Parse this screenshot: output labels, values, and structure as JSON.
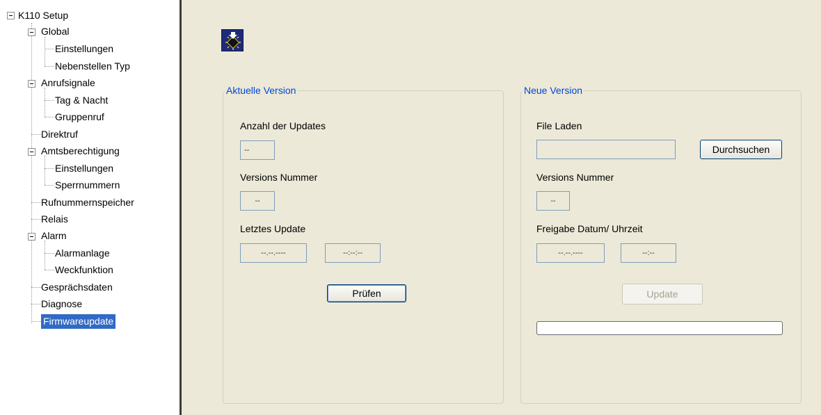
{
  "tree": {
    "root": "K110 Setup",
    "items": [
      {
        "label": "Global"
      },
      {
        "label": "Einstellungen"
      },
      {
        "label": "Nebenstellen Typ"
      },
      {
        "label": "Anrufsignale"
      },
      {
        "label": "Tag & Nacht"
      },
      {
        "label": "Gruppenruf"
      },
      {
        "label": "Direktruf"
      },
      {
        "label": "Amtsberechtigung"
      },
      {
        "label": "Einstellungen"
      },
      {
        "label": "Sperrnummern"
      },
      {
        "label": "Rufnummernspeicher"
      },
      {
        "label": "Relais"
      },
      {
        "label": "Alarm"
      },
      {
        "label": "Alarmanlage"
      },
      {
        "label": "Weckfunktion"
      },
      {
        "label": "Gesprächsdaten"
      },
      {
        "label": "Diagnose"
      },
      {
        "label": "Firmwareupdate"
      }
    ],
    "selected": "Firmwareupdate"
  },
  "header": {
    "icon": "firmware-chip-icon"
  },
  "current": {
    "legend": "Aktuelle Version",
    "updates_label": "Anzahl der Updates",
    "updates_value": "--",
    "version_label": "Versions Nummer",
    "version_value": "--",
    "last_update_label": "Letztes Update",
    "last_update_date": "--.--.----",
    "last_update_time": "--:--:--",
    "check_button": "Prüfen"
  },
  "new": {
    "legend": "Neue Version",
    "file_label": "File Laden",
    "file_value": "",
    "browse_button": "Durchsuchen",
    "version_label": "Versions Nummer",
    "version_value": "--",
    "release_label": "Freigabe Datum/ Uhrzeit",
    "release_date": "--.--.----",
    "release_time": "--:--",
    "update_button": "Update",
    "progress": 0
  },
  "colors": {
    "selection": "#316ac5",
    "panel": "#ece9d8",
    "legend": "#0046d5"
  }
}
